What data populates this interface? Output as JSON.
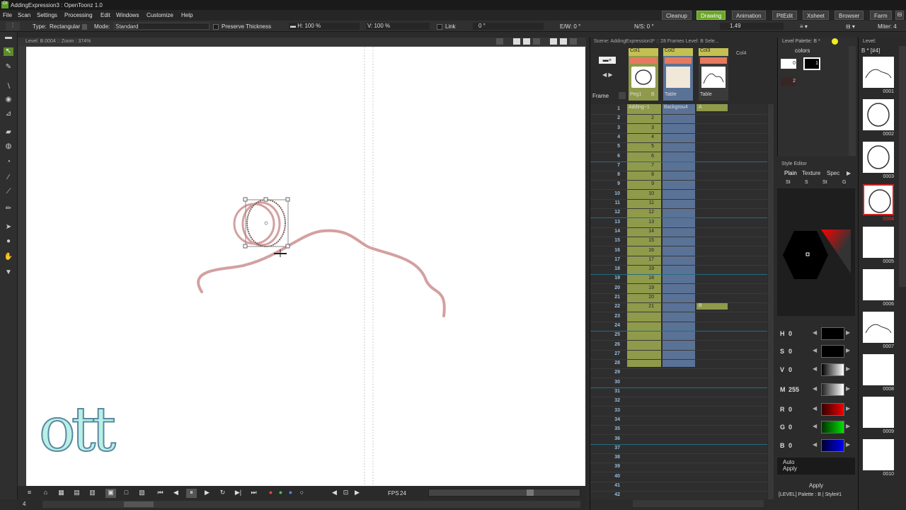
{
  "window": {
    "title": "AddingExpression3 : OpenToonz 1.0"
  },
  "menu": [
    "File",
    "Scan",
    "Settings",
    "Processing",
    "Edit",
    "Windows",
    "Customize",
    "Help"
  ],
  "rooms": [
    {
      "label": "Cleanup",
      "active": false
    },
    {
      "label": "Drawing",
      "active": true
    },
    {
      "label": "Animation",
      "active": false
    },
    {
      "label": "PltEdit",
      "active": false
    },
    {
      "label": "Xsheet",
      "active": false
    },
    {
      "label": "Browser",
      "active": false
    },
    {
      "label": "Farm",
      "active": false
    }
  ],
  "tool_options": {
    "type_label": "Type:",
    "type_value": "Rectangular",
    "mode_label": "Mode:",
    "mode_value": "Standard",
    "preserve_thickness": "Preserve Thickness",
    "h_label": "H: 100 %",
    "v_label": "V: 100 %",
    "link": "Link",
    "rotation": "0 °",
    "ew": "E/W: 0 °",
    "ns": "N/S: 0 °",
    "thickness": "1.49",
    "miter": "Miter: 4"
  },
  "viewer": {
    "header": "Level: B.0004  ::  Zoom : 374%"
  },
  "playback": {
    "fps_label": "FPS",
    "fps_value": "24",
    "frame_value": "4"
  },
  "xsheet": {
    "scene_info": "Scene: AddingExpression3*  ::  28 Frames  Level: B  Sele...",
    "frame_label": "Frame",
    "columns": [
      {
        "name": "Col1",
        "pegbar": "Peg1",
        "sub": "B"
      },
      {
        "name": "Col2",
        "pegbar": "Table",
        "sub": ""
      },
      {
        "name": "Col3",
        "pegbar": "Table",
        "sub": ""
      },
      {
        "name": "Col4",
        "pegbar": "",
        "sub": ""
      }
    ],
    "col1_level": "Adding~1",
    "col2_level": "Backgrou4",
    "col3_level": "A",
    "col3_level_b": "B",
    "col1_cells": [
      "1",
      "2",
      "3",
      "4",
      "5",
      "6",
      "7",
      "8",
      "9",
      "10",
      "11",
      "12",
      "13",
      "14",
      "15",
      "16",
      "17",
      "19",
      "18",
      "19",
      "20",
      "21"
    ],
    "rows": [
      "1",
      "2",
      "3",
      "4",
      "5",
      "6",
      "7",
      "8",
      "9",
      "10",
      "11",
      "12",
      "13",
      "14",
      "15",
      "16",
      "17",
      "18",
      "19",
      "20",
      "21",
      "22",
      "23",
      "24",
      "25",
      "26",
      "27",
      "28",
      "29",
      "30",
      "31",
      "32",
      "33",
      "34",
      "35",
      "36",
      "37",
      "38",
      "39",
      "40",
      "41",
      "42"
    ]
  },
  "palette": {
    "title": "Level Palette: B *",
    "name": "colors",
    "style_num_0": "0",
    "style_num_1": "1",
    "style_num_2": "2"
  },
  "style_editor": {
    "title": "Style Editor",
    "tabs": [
      "Plain",
      "Texture",
      "Spec"
    ],
    "subtabs": [
      "St",
      "S",
      "St",
      "G"
    ],
    "channels": [
      {
        "name": "H",
        "value": "0",
        "color": "#000000"
      },
      {
        "name": "S",
        "value": "0",
        "color": "#000000"
      },
      {
        "name": "V",
        "value": "0",
        "color": "#000000"
      },
      {
        "name": "M",
        "value": "255",
        "color": "#dddddd"
      },
      {
        "name": "R",
        "value": "0",
        "color": "#d00000"
      },
      {
        "name": "G",
        "value": "0",
        "color": "#00c000"
      },
      {
        "name": "B",
        "value": "0",
        "color": "#0000d0"
      }
    ],
    "auto_apply": "Auto Apply",
    "apply": "Apply",
    "footer": "[LEVEL]  Palette : B | Style#1"
  },
  "level_strip": {
    "title": "Level: ",
    "level": "B * [#4]",
    "frames": [
      "0001",
      "0002",
      "0003",
      "0004",
      "0005",
      "0006",
      "0007",
      "0008",
      "0009",
      "0010"
    ]
  },
  "logo": "ott",
  "colors": {
    "accent": "#6aa528",
    "stroke": "#d4a0a0",
    "col1": "#8f9a4b",
    "col2": "#5a7296"
  }
}
